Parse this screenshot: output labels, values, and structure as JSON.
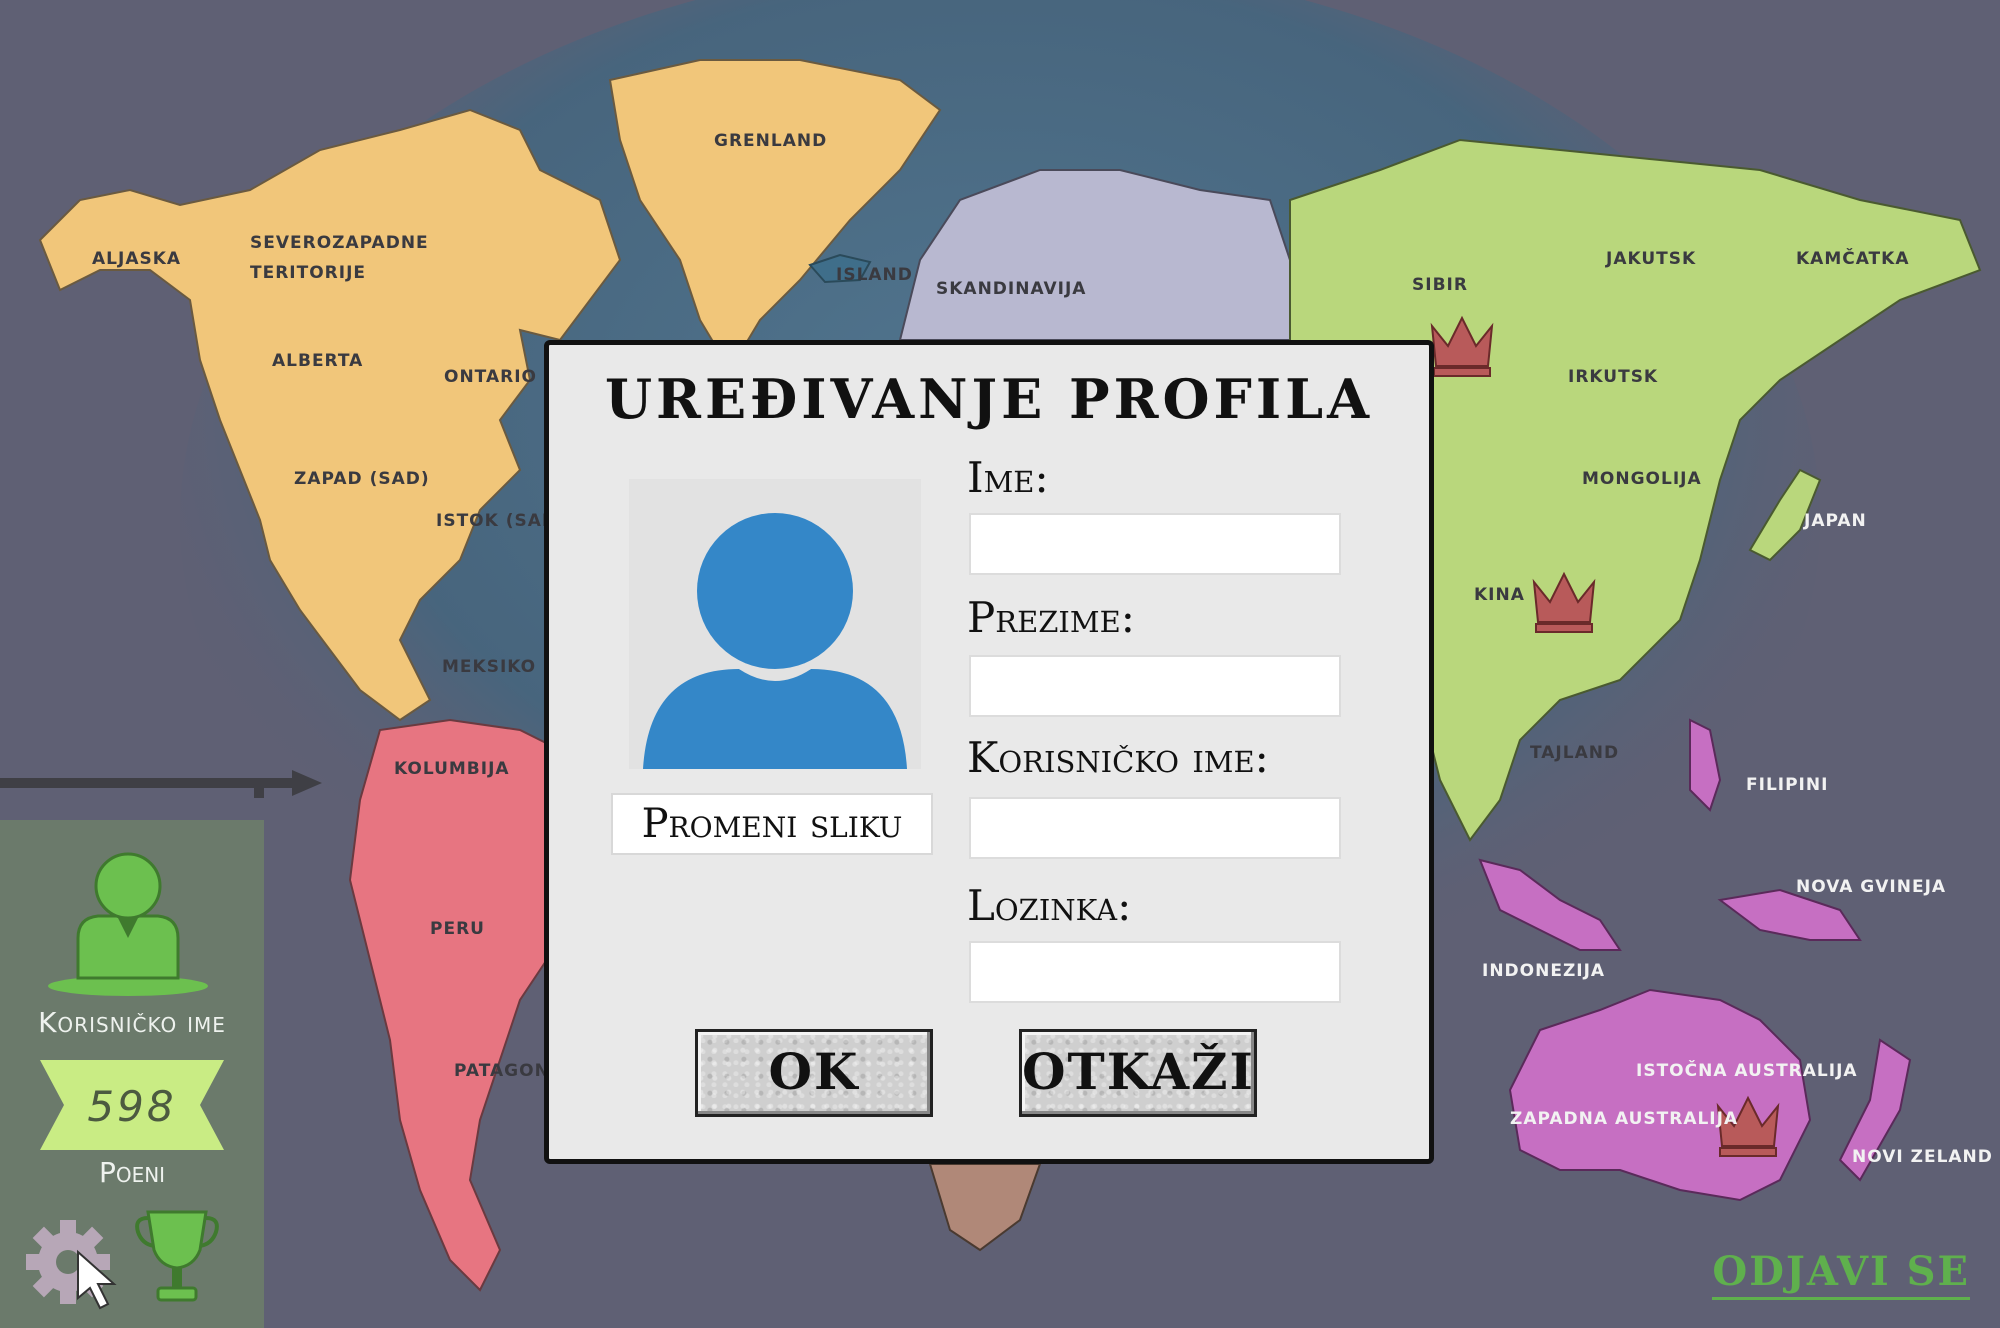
{
  "dialog": {
    "title": "UREĐIVANJE PROFILA",
    "change_photo_label": "Promeni sliku",
    "fields": {
      "first_name_label": "Ime:",
      "last_name_label": "Prezime:",
      "username_label": "Korisničko ime:",
      "password_label": "Lozinka:"
    },
    "ok_label": "OK",
    "cancel_label": "OTKAŽI"
  },
  "side_panel": {
    "username": "Korisničko ime",
    "points": "598",
    "points_label": "Poeni"
  },
  "logout_label": "ODJAVI SE",
  "map": {
    "regions": {
      "aljaska": "ALJASKA",
      "severozapadne_1": "SEVEROZAPADNE",
      "severozapadne_2": "TERITORIJE",
      "grenland": "GRENLAND",
      "alberta": "ALBERTA",
      "ontario": "ONTARIO",
      "zapad_sad": "ZAPAD (SAD)",
      "istok_sad": "ISTOK (SAD)",
      "meksiko": "MEKSIKO",
      "kolumbija": "KOLUMBIJA",
      "peru": "PERU",
      "patagonija": "PATAGONIJA",
      "island": "ISLAND",
      "skandinavija": "SKANDINAVIJA",
      "sibir": "SIBIR",
      "jakutsk": "JAKUTSK",
      "kamcatka": "KAMČATKA",
      "irkutsk": "IRKUTSK",
      "mongolija": "MONGOLIJA",
      "japan": "JAPAN",
      "kina": "KINA",
      "tajland": "TAJLAND",
      "filipini": "FILIPINI",
      "nova_gvineja": "NOVA GVINEJA",
      "indonezija": "INDONEZIJA",
      "istocna_australija": "ISTOČNA AUSTRALIJA",
      "zapadna_australija": "ZAPADNA AUSTRALIJA",
      "novi_zeland": "NOVI ZELAND"
    },
    "colors": {
      "background": "#5f6074",
      "ocean": "#3f6e8a",
      "north_america": "#f1c67a",
      "south_america": "#e77581",
      "europe": "#b8b8d0",
      "asia": "#b9d77c",
      "oceania": "#c66fc2",
      "africa": "#b08878",
      "crown": "#b85a5a"
    },
    "icons": [
      "crown-icon-sibir",
      "crown-icon-kina",
      "crown-icon-australija"
    ]
  }
}
